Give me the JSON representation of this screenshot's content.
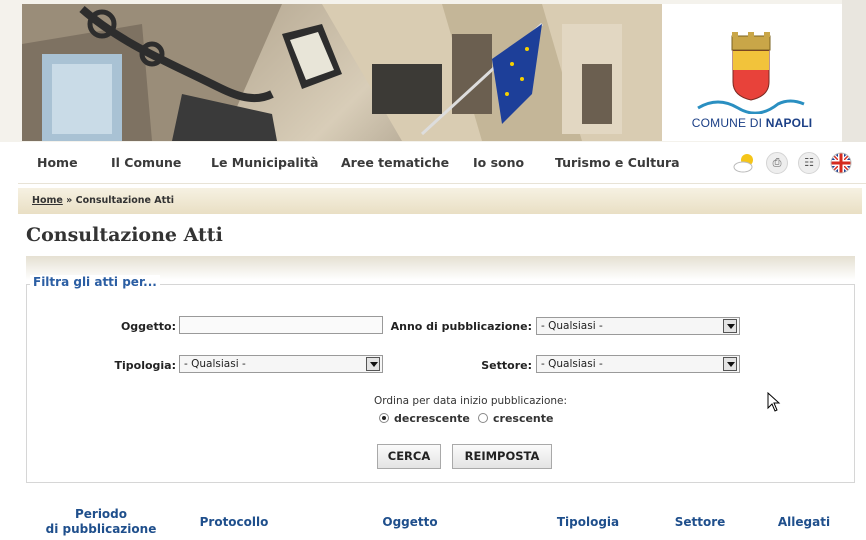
{
  "header": {
    "logo_text_light": "COMUNE DI",
    "logo_text_bold": "NAPOLI"
  },
  "nav": {
    "items": [
      "Home",
      "Il Comune",
      "Le Municipalità",
      "Aree tematiche",
      "Io sono",
      "Turismo e Cultura"
    ]
  },
  "breadcrumb": {
    "home": "Home",
    "separator": "»",
    "current": "Consultazione Atti"
  },
  "page": {
    "title": "Consultazione Atti"
  },
  "filter": {
    "legend": "Filtra gli atti per...",
    "oggetto_label": "Oggetto:",
    "oggetto_value": "",
    "anno_label": "Anno di pubblicazione:",
    "anno_value": "- Qualsiasi -",
    "tipologia_label": "Tipologia:",
    "tipologia_value": "- Qualsiasi -",
    "settore_label": "Settore:",
    "settore_value": "- Qualsiasi -",
    "order_label": "Ordina per data inizio pubblicazione:",
    "order_desc": "decrescente",
    "order_asc": "crescente",
    "order_selected": "decrescente",
    "search_button": "CERCA",
    "reset_button": "REIMPOSTA"
  },
  "results": {
    "columns": [
      "Periodo",
      "di pubblicazione",
      "Protocollo",
      "Oggetto",
      "Tipologia",
      "Settore",
      "Allegati"
    ]
  },
  "colors": {
    "accent_blue": "#2b5ea3",
    "breadcrumb_bg": "#efe6cf"
  }
}
